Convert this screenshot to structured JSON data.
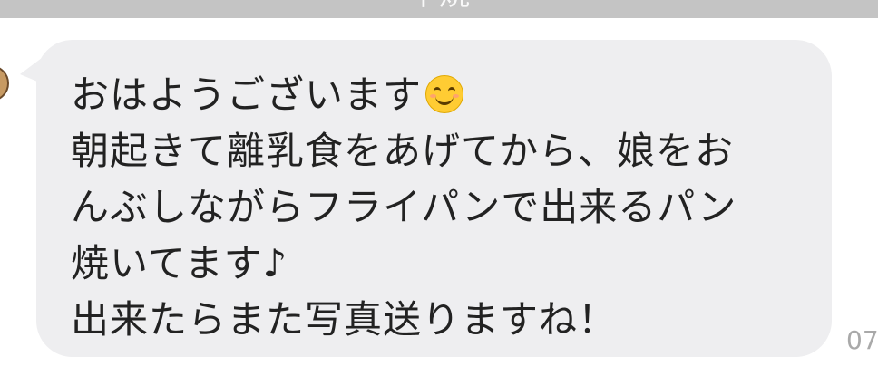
{
  "header": {
    "partial_text": "ー・ー中焼ー・ー"
  },
  "message": {
    "lines": [
      "おはようございます",
      "朝起きて離乳食をあげてから、娘をお",
      "んぶしながらフライパンで出来るパン",
      "焼いてます♪",
      "出来たらまた写真送りますね！"
    ],
    "emoji": "smiling-face-icon",
    "timestamp": "07"
  },
  "colors": {
    "bubble": "#eeeef0",
    "text": "#222222",
    "timestamp": "#a9a9a9",
    "top_bar": "#c4c4c4"
  }
}
